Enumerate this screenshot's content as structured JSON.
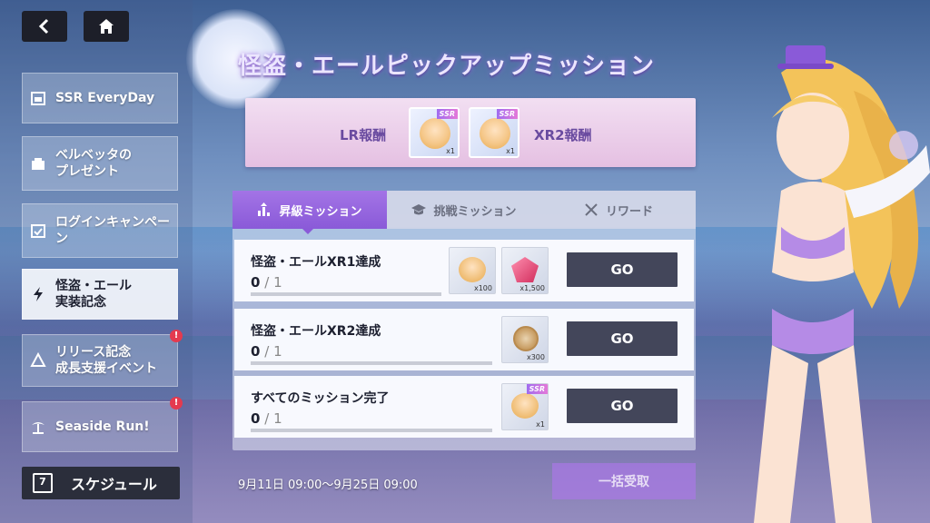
{
  "nav": {
    "back_icon": "chevron-left-icon",
    "home_icon": "home-icon"
  },
  "sidebar": {
    "items": [
      {
        "label": "SSR EveryDay",
        "icon": "calendar-ssr-icon",
        "active": false,
        "alert": false
      },
      {
        "label": "ベルベッタの\nプレゼント",
        "icon": "gift-box-icon",
        "active": false,
        "alert": false
      },
      {
        "label": "ログインキャンペー\nン",
        "icon": "calendar-check-icon",
        "active": false,
        "alert": false
      },
      {
        "label": "怪盗・エール\n実装記念",
        "icon": "lightning-icon",
        "active": true,
        "alert": false
      },
      {
        "label": "リリース記念\n成長支援イベント",
        "icon": "triangle-arrows-icon",
        "active": false,
        "alert": true
      },
      {
        "label": "Seaside Run!",
        "icon": "palm-tree-icon",
        "active": false,
        "alert": true
      }
    ],
    "alert_symbol": "!",
    "schedule": {
      "label": "スケジュール",
      "day": "7"
    }
  },
  "event": {
    "title": "怪盗・エールピックアップミッション",
    "banner": {
      "lr_label": "LR報酬",
      "xr_label": "XR2報酬",
      "lr_reward": {
        "badge": "SSR",
        "qty": "x1"
      },
      "xr_reward": {
        "badge": "SSR",
        "qty": "x1"
      }
    }
  },
  "tabs": [
    {
      "label": "昇級ミッション",
      "icon": "bar-up-icon",
      "active": true
    },
    {
      "label": "挑戦ミッション",
      "icon": "graduation-cap-icon",
      "active": false
    },
    {
      "label": "リワード",
      "icon": "crossed-swords-icon",
      "active": false
    }
  ],
  "missions": [
    {
      "name": "怪盗・エールXR1達成",
      "current": "0",
      "sep": "/",
      "total": "1",
      "progress": 0,
      "rewards": [
        {
          "icon": "character-portrait-icon",
          "qty": "x100"
        },
        {
          "icon": "red-gem-icon",
          "qty": "x1,500"
        }
      ],
      "button": "GO"
    },
    {
      "name": "怪盗・エールXR2達成",
      "current": "0",
      "sep": "/",
      "total": "1",
      "progress": 0,
      "rewards": [
        {
          "icon": "medal-icon",
          "qty": "x300"
        }
      ],
      "button": "GO"
    },
    {
      "name": "すべてのミッション完了",
      "current": "0",
      "sep": "/",
      "total": "1",
      "progress": 0,
      "rewards": [
        {
          "icon": "ssr-card-icon",
          "badge": "SSR",
          "qty": "x1"
        }
      ],
      "button": "GO"
    }
  ],
  "period": "9月11日 09:00～9月25日 09:00",
  "claim_all": "一括受取",
  "colors": {
    "accent": "#8a5ad8",
    "button_dark": "#43465a",
    "alert": "#e43a4f"
  }
}
